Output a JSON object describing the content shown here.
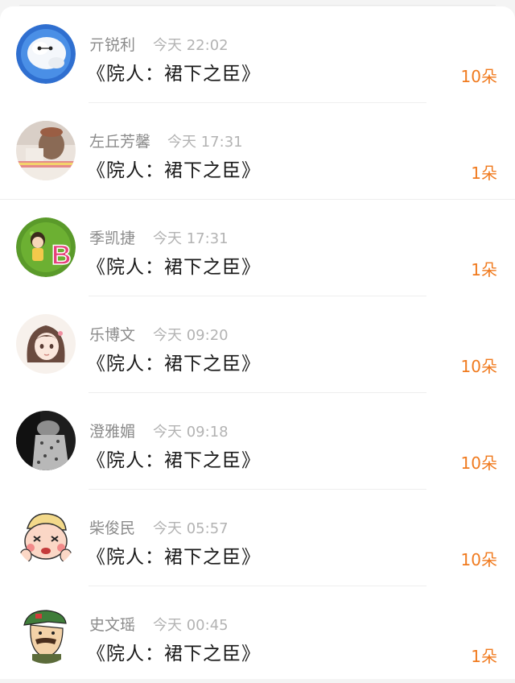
{
  "colors": {
    "accent": "#f07a1e",
    "name_text": "#8b8b8b",
    "time_text": "#b3b3b3",
    "title_text": "#1a1a1a"
  },
  "comments": [
    {
      "name": "亓锐利",
      "time": "今天 22:02",
      "title": "《院人：裙下之臣》",
      "gift": "10朵",
      "avatar_icon": "baymax-avatar-icon"
    },
    {
      "name": "左丘芳馨",
      "time": "今天 17:31",
      "title": "《院人：裙下之臣》",
      "gift": "1朵",
      "avatar_icon": "photo-avatar-icon"
    },
    {
      "name": "季凯捷",
      "time": "今天 17:31",
      "title": "《院人：裙下之臣》",
      "gift": "1朵",
      "avatar_icon": "letter-b-avatar-icon"
    },
    {
      "name": "乐博文",
      "time": "今天 09:20",
      "title": "《院人：裙下之臣》",
      "gift": "10朵",
      "avatar_icon": "anime-girl-avatar-icon"
    },
    {
      "name": "澄雅媚",
      "time": "今天 09:18",
      "title": "《院人：裙下之臣》",
      "gift": "10朵",
      "avatar_icon": "grayscale-photo-avatar-icon"
    },
    {
      "name": "柴俊民",
      "time": "今天 05:57",
      "title": "《院人：裙下之臣》",
      "gift": "10朵",
      "avatar_icon": "cartoon-kid-avatar-icon"
    },
    {
      "name": "史文瑶",
      "time": "今天 00:45",
      "title": "《院人：裙下之臣》",
      "gift": "1朵",
      "avatar_icon": "cartoon-soldier-avatar-icon"
    }
  ]
}
